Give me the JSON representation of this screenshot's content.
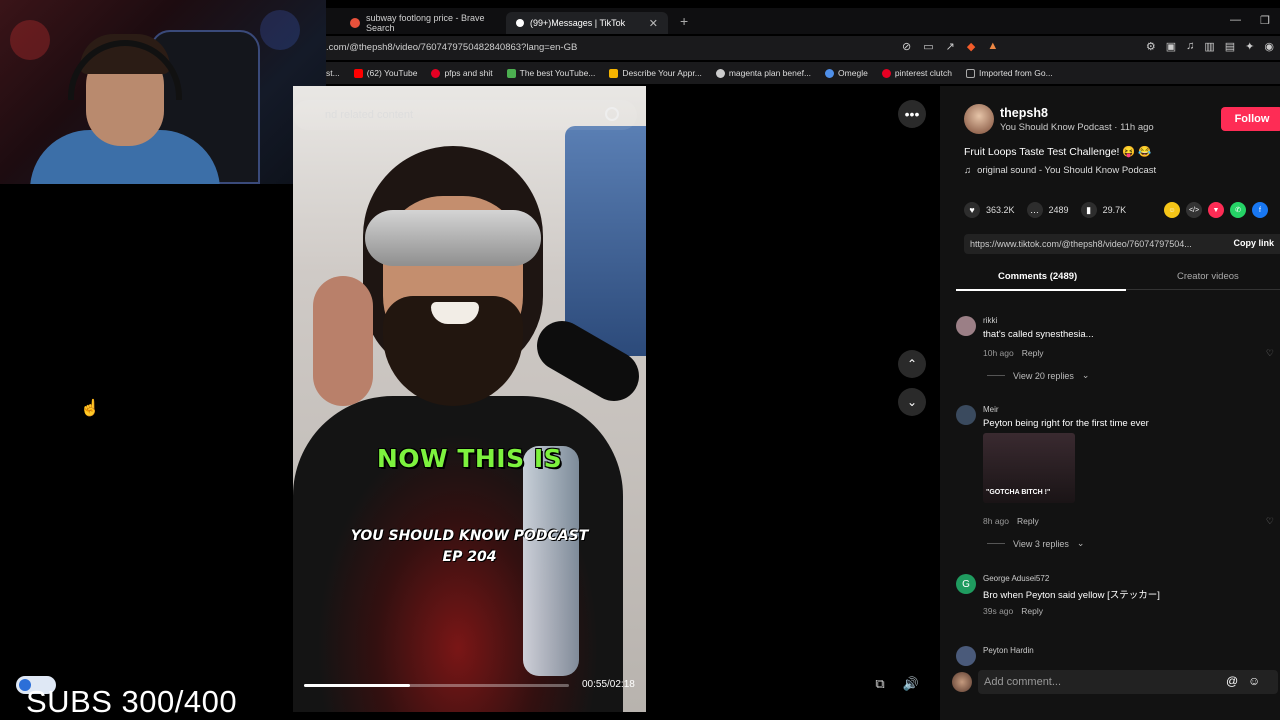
{
  "browser": {
    "tabs": [
      {
        "label": "subway footlong price - Brave Search",
        "favicon_color": "#e8513b"
      },
      {
        "label": "(99+)Messages | TikTok",
        "favicon_color": "#ffffff"
      }
    ],
    "url": ".com/@thepsh8/video/7607479750482840863?lang=en-GB",
    "bookmarks": [
      {
        "label": "st...",
        "color": "#888888"
      },
      {
        "label": "(62) YouTube",
        "color": "#ff0000"
      },
      {
        "label": "pfps and shit",
        "color": "#e60023"
      },
      {
        "label": "The best YouTube...",
        "color": "#4caf50"
      },
      {
        "label": "Describe Your Appr...",
        "color": "#f5b400"
      },
      {
        "label": "magenta plan benef...",
        "color": "#cccccc"
      },
      {
        "label": "Omegle",
        "color": "#4f8fe8"
      },
      {
        "label": "pinterest clutch",
        "color": "#e60023"
      },
      {
        "label": "Imported from Go...",
        "color": "#aaaaaa"
      }
    ]
  },
  "overlay": {
    "subs_text": "SUBS 300/400"
  },
  "video": {
    "search_placeholder": "nd related content",
    "caption_main": "NOW THIS IS",
    "caption_sub1": "YOU SHOULD KNOW PODCAST",
    "caption_sub2": "EP 204",
    "timecode": "00:55/02:18",
    "progress": 0.4
  },
  "post": {
    "username": "thepsh8",
    "subtitle": "You Should Know Podcast · 11h ago",
    "follow_label": "Follow",
    "description": "Fruit Loops Taste Test Challenge! 😝 😂",
    "sound": "original sound - You Should Know Podcast",
    "likes": "363.2K",
    "comments": "2489",
    "saves": "29.7K",
    "link": "https://www.tiktok.com/@thepsh8/video/76074797504...",
    "copy_label": "Copy link",
    "tab_comments": "Comments (2489)",
    "tab_creator": "Creator videos",
    "add_comment_placeholder": "Add comment..."
  },
  "comments": [
    {
      "user": "rikki",
      "text": "that's called synesthesia...",
      "time": "10h ago",
      "reply": "Reply",
      "replies": "View 20 replies",
      "avatar_color": "#9b7f86"
    },
    {
      "user": "Meir",
      "text": "Peyton being right for the first time ever",
      "time": "8h ago",
      "reply": "Reply",
      "replies": "View 3 replies",
      "gif_text": "\"GOTCHA BITCH !\"",
      "avatar_color": "#3a4a5e"
    },
    {
      "user": "George Adusei572",
      "text": "Bro when Peyton said yellow [ステッカー]",
      "time": "39s ago",
      "reply": "Reply",
      "avatar_letter": "G",
      "avatar_color": "#1f9b5f"
    },
    {
      "user": "Peyton Hardin",
      "avatar_color": "#4a5a7a"
    }
  ],
  "colors": {
    "follow": "#fe2c55",
    "caption_green": "#7df23e"
  }
}
